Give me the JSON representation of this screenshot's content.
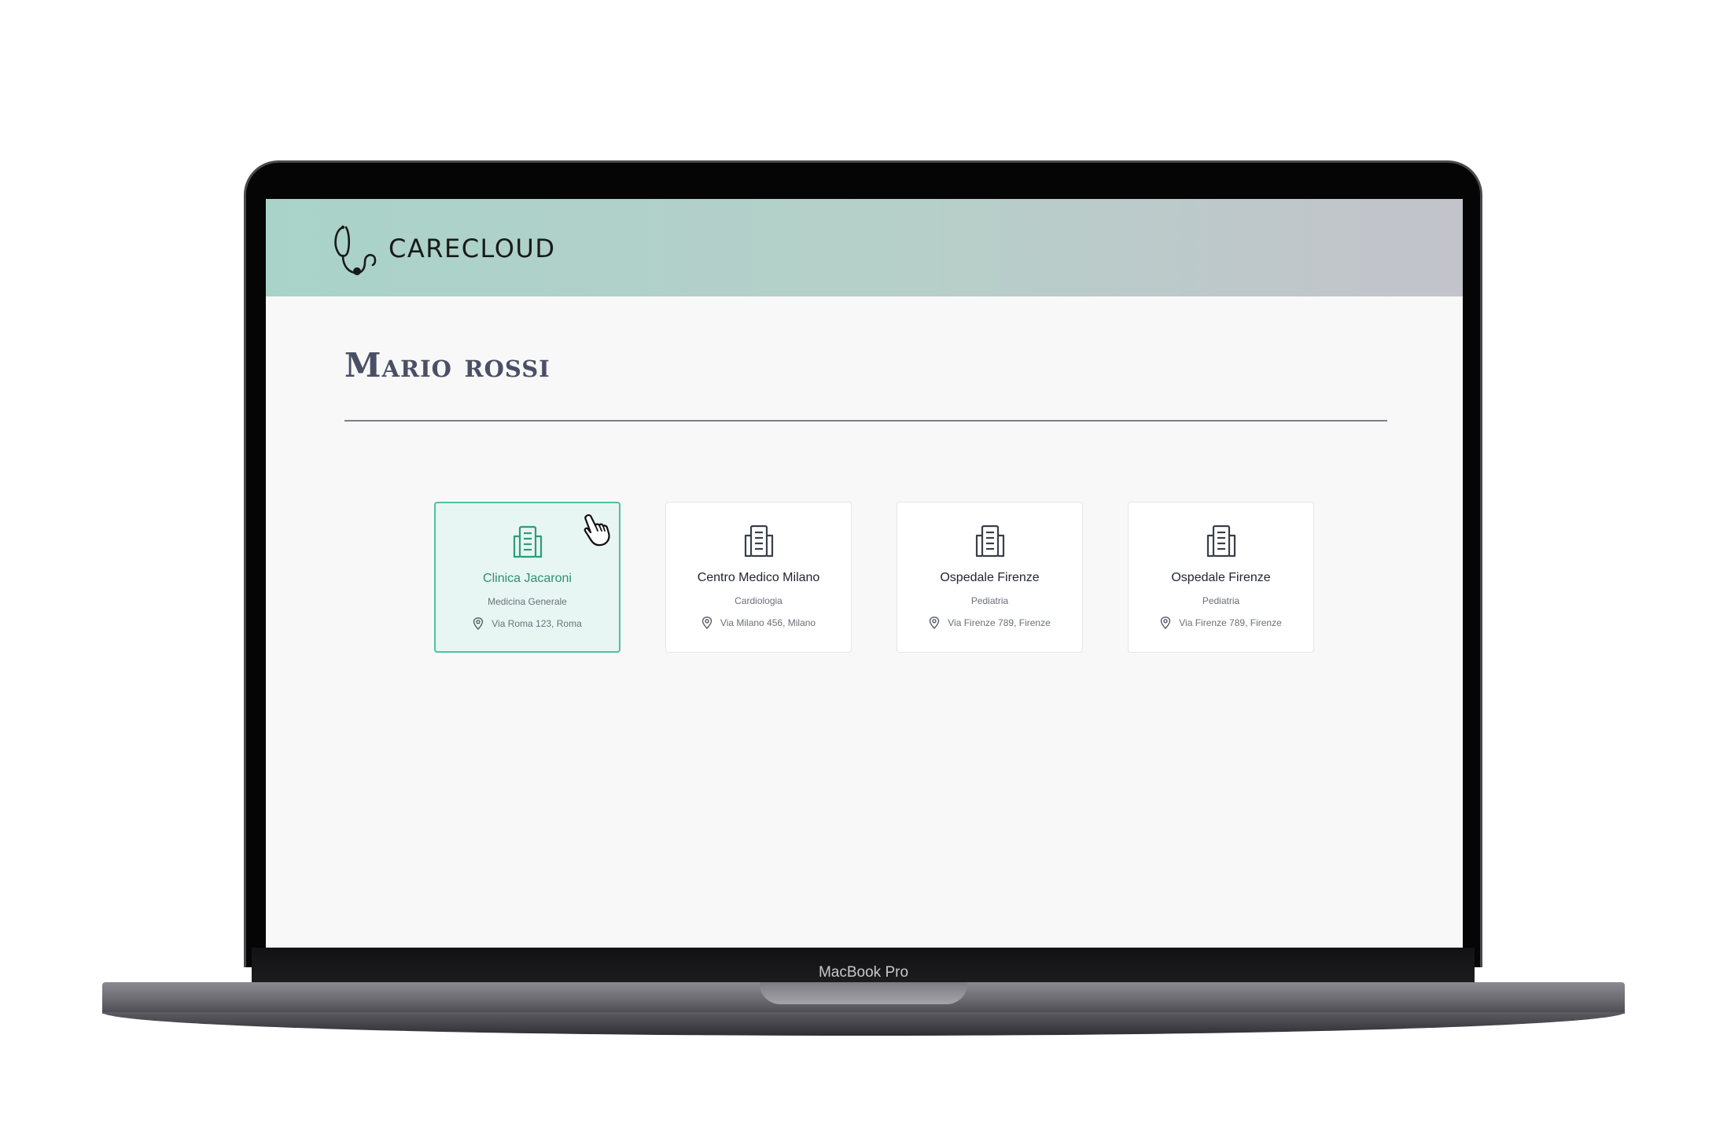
{
  "app": {
    "logo_text": "CARECLOUD",
    "logo_icon": "stethoscope-icon"
  },
  "page": {
    "title": "Mario rossi"
  },
  "clinics": [
    {
      "name": "Clinica Jacaroni",
      "specialty": "Medicina Generale",
      "address": "Via Roma 123, Roma",
      "selected": true
    },
    {
      "name": "Centro Medico Milano",
      "specialty": "Cardiologia",
      "address": "Via Milano 456, Milano",
      "selected": false
    },
    {
      "name": "Ospedale Firenze",
      "specialty": "Pediatria",
      "address": "Via Firenze 789, Firenze",
      "selected": false
    },
    {
      "name": "Ospedale Firenze",
      "specialty": "Pediatria",
      "address": "Via Firenze 789, Firenze",
      "selected": false
    }
  ],
  "device": {
    "label": "MacBook Pro"
  },
  "colors": {
    "accent": "#4fbfa2",
    "accent_text": "#2e8f72",
    "title": "#4b4f66",
    "header_start": "#a9d3c9",
    "header_end": "#c3c3cb"
  },
  "icons": {
    "clinic": "building-icon",
    "address": "map-pin-icon",
    "cursor": "hand-pointer-icon"
  }
}
